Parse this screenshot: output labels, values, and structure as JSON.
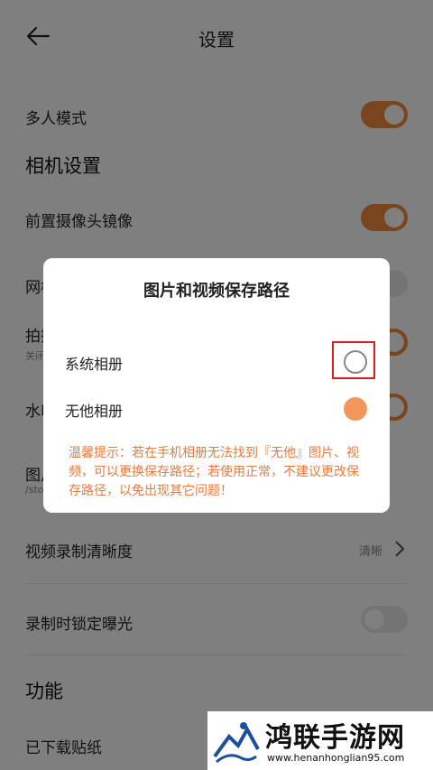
{
  "header": {
    "title": "设置"
  },
  "settings": {
    "multi_user_label": "多人模式",
    "camera_section": "相机设置",
    "front_mirror_label": "前置摄像头镜像",
    "grid_label": "网格",
    "shoot_label": "拍摄静音设置",
    "shoot_sub": "关闭后拍照将有快门声",
    "watermark_label": "水印",
    "storage_label": "图片存储路径",
    "storage_sub": "/storage",
    "video_quality_label": "视频录制清晰度",
    "video_quality_value": "清晰",
    "lock_exposure_label": "录制时锁定曝光",
    "function_section": "功能",
    "downloaded_stickers_label": "已下载贴纸"
  },
  "toggles": {
    "multi_user": true,
    "front_mirror": true,
    "lock_exposure": false
  },
  "dialog": {
    "title": "图片和视频保存路径",
    "options": [
      {
        "label": "系统相册",
        "selected": false
      },
      {
        "label": "无他相册",
        "selected": true
      }
    ],
    "hint": "温馨提示：若在手机相册无法找到『无他』图片、视频，可以更换保存路径；若使用正常，不建议更改保存路径，以免出现其它问题！"
  },
  "colors": {
    "accent": "#f08a3c",
    "hint": "#e87a3a",
    "highlight": "#d81e1e"
  },
  "watermark": {
    "name": "鸿联手游网",
    "url": "www.henanhonglian95.com"
  }
}
